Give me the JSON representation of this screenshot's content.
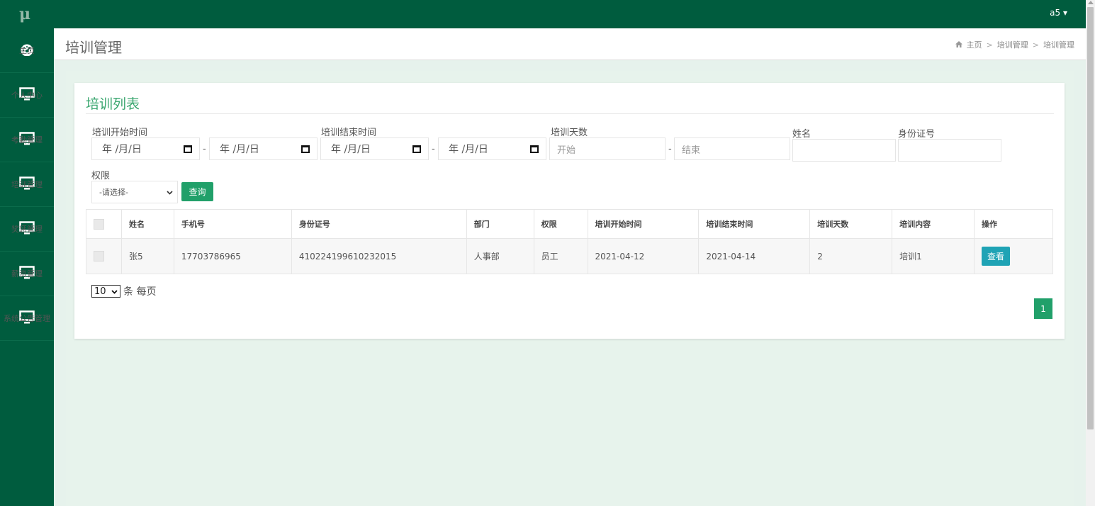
{
  "sidebar": {
    "logo": "μ",
    "items": [
      {
        "label": "主页",
        "icon": "dashboard-icon"
      },
      {
        "label": "个人中心",
        "icon": "monitor-icon"
      },
      {
        "label": "考勤管理",
        "icon": "monitor-icon"
      },
      {
        "label": "培训管理",
        "icon": "monitor-icon"
      },
      {
        "label": "奖惩管理",
        "icon": "monitor-icon"
      },
      {
        "label": "薪资管理",
        "icon": "monitor-icon"
      },
      {
        "label": "系统公告管理",
        "icon": "monitor-icon"
      }
    ]
  },
  "topbar": {
    "user": "a5 ▾"
  },
  "header": {
    "title": "培训管理",
    "breadcrumb": [
      "主页",
      "培训管理",
      "培训管理"
    ],
    "breadcrumb_sep": ">"
  },
  "card": {
    "title": "培训列表"
  },
  "filters": {
    "start_time_label": "培训开始时间",
    "end_time_label": "培训结束时间",
    "days_label": "培训天数",
    "name_label": "姓名",
    "idcard_label": "身份证号",
    "role_label": "权限",
    "date_placeholder": "年 /月/日",
    "days_start_placeholder": "开始",
    "days_end_placeholder": "结束",
    "dash": "-",
    "role_select_value": "-请选择-",
    "query_button": "查询"
  },
  "table": {
    "headers": [
      "姓名",
      "手机号",
      "身份证号",
      "部门",
      "权限",
      "培训开始时间",
      "培训结束时间",
      "培训天数",
      "培训内容",
      "操作"
    ],
    "rows": [
      {
        "name": "张5",
        "phone": "17703786965",
        "idcard": "410224199610232015",
        "dept": "人事部",
        "role": "员工",
        "start": "2021-04-12",
        "end": "2021-04-14",
        "days": "2",
        "content": "培训1",
        "action": "查看"
      }
    ]
  },
  "pagination": {
    "page_size": "10",
    "page_size_suffix": "条 每页",
    "current_page": "1"
  },
  "colors": {
    "sidebar_bg": "#005c3e",
    "accent_green": "#21a06a",
    "title_green": "#3aa66f",
    "view_button": "#1fa3b5"
  }
}
